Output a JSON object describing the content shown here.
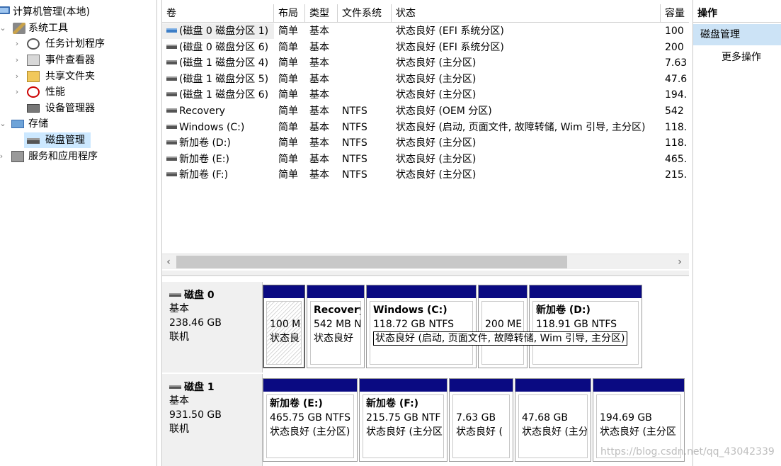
{
  "tree": {
    "root": "计算机管理(本地)",
    "system_tools": "系统工具",
    "task_scheduler": "任务计划程序",
    "event_viewer": "事件查看器",
    "shared_folders": "共享文件夹",
    "performance": "性能",
    "device_manager": "设备管理器",
    "storage": "存储",
    "disk_management": "磁盘管理",
    "services": "服务和应用程序"
  },
  "volume_table": {
    "headers": [
      "卷",
      "布局",
      "类型",
      "文件系统",
      "状态",
      "容量"
    ],
    "rows": [
      {
        "volume": "(磁盘 0 磁盘分区 1)",
        "layout": "简单",
        "type": "基本",
        "fs": "",
        "status": "状态良好 (EFI 系统分区)",
        "capacity": "100"
      },
      {
        "volume": "(磁盘 0 磁盘分区 6)",
        "layout": "简单",
        "type": "基本",
        "fs": "",
        "status": "状态良好 (EFI 系统分区)",
        "capacity": "200"
      },
      {
        "volume": "(磁盘 1 磁盘分区 4)",
        "layout": "简单",
        "type": "基本",
        "fs": "",
        "status": "状态良好 (主分区)",
        "capacity": "7.63"
      },
      {
        "volume": "(磁盘 1 磁盘分区 5)",
        "layout": "简单",
        "type": "基本",
        "fs": "",
        "status": "状态良好 (主分区)",
        "capacity": "47.6"
      },
      {
        "volume": "(磁盘 1 磁盘分区 6)",
        "layout": "简单",
        "type": "基本",
        "fs": "",
        "status": "状态良好 (主分区)",
        "capacity": "194."
      },
      {
        "volume": "Recovery",
        "layout": "简单",
        "type": "基本",
        "fs": "NTFS",
        "status": "状态良好 (OEM 分区)",
        "capacity": "542"
      },
      {
        "volume": "Windows (C:)",
        "layout": "简单",
        "type": "基本",
        "fs": "NTFS",
        "status": "状态良好 (启动, 页面文件, 故障转储, Wim 引导, 主分区)",
        "capacity": "118."
      },
      {
        "volume": "新加卷 (D:)",
        "layout": "简单",
        "type": "基本",
        "fs": "NTFS",
        "status": "状态良好 (主分区)",
        "capacity": "118."
      },
      {
        "volume": "新加卷 (E:)",
        "layout": "简单",
        "type": "基本",
        "fs": "NTFS",
        "status": "状态良好 (主分区)",
        "capacity": "465."
      },
      {
        "volume": "新加卷 (F:)",
        "layout": "简单",
        "type": "基本",
        "fs": "NTFS",
        "status": "状态良好 (主分区)",
        "capacity": "215."
      }
    ]
  },
  "disks": [
    {
      "name": "磁盘 0",
      "kind": "基本",
      "size": "238.46 GB",
      "state": "联机",
      "partitions": [
        {
          "title": "",
          "line1": "100 M",
          "line2": "状态良"
        },
        {
          "title": "Recovery",
          "line1": "542 MB N",
          "line2": "状态良好"
        },
        {
          "title": "Windows (C:)",
          "line1": "118.72 GB NTFS",
          "line2": "状态良好 (启动, 页面文件, 故障转储, Wim 引导, 主分区)"
        },
        {
          "title": "",
          "line1": "200 ME",
          "line2": ""
        },
        {
          "title": "新加卷 (D:)",
          "line1": "118.91 GB NTFS",
          "line2": ""
        }
      ]
    },
    {
      "name": "磁盘 1",
      "kind": "基本",
      "size": "931.50 GB",
      "state": "联机",
      "partitions": [
        {
          "title": "新加卷 (E:)",
          "line1": "465.75 GB NTFS",
          "line2": "状态良好 (主分区)"
        },
        {
          "title": "新加卷 (F:)",
          "line1": "215.75 GB NTF",
          "line2": "状态良好 (主分区"
        },
        {
          "title": "",
          "line1": "7.63 GB",
          "line2": "状态良好 ("
        },
        {
          "title": "",
          "line1": "47.68 GB",
          "line2": "状态良好 (主分"
        },
        {
          "title": "",
          "line1": "194.69 GB",
          "line2": "状态良好 (主分区"
        }
      ]
    }
  ],
  "actions": {
    "header": "操作",
    "section": "磁盘管理",
    "more": "更多操作"
  },
  "scroll": {
    "left": "‹",
    "right": "›"
  },
  "watermark": "https://blog.csdn.net/qq_43042339"
}
